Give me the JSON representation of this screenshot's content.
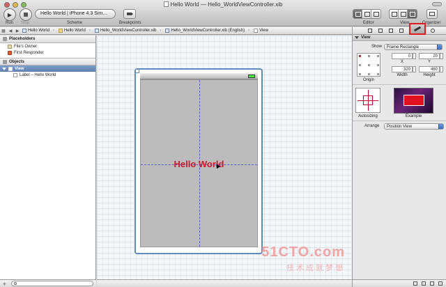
{
  "window": {
    "title": "Hello World — Hello_WorldViewController.xib"
  },
  "toolbar": {
    "run_label": "Run",
    "stop_label": "Stop",
    "scheme_value": "Hello World | iPhone 4.3 Sim…",
    "scheme_label": "Scheme",
    "breakpoints_label": "Breakpoints",
    "editor_label": "Editor",
    "view_label": "View",
    "organizer_label": "Organizer"
  },
  "jumpbar": {
    "crumbs": [
      "Hello World",
      "Hello World",
      "Hello_WorldViewController.xib",
      "Hello_WorldViewController.xib (English)",
      "View"
    ]
  },
  "navigator": {
    "placeholders_header": "Placeholders",
    "files_owner": "File's Owner",
    "first_responder": "First Responder",
    "objects_header": "Objects",
    "view_item": "View",
    "label_item": "Label – Hello World"
  },
  "canvas": {
    "label_text": "Hello World"
  },
  "watermark": {
    "logo": "51CTO.com",
    "sub": "技术成就梦想"
  },
  "inspector": {
    "section": "View",
    "show_label": "Show",
    "show_value": "Frame Rectangle",
    "x_value": "0",
    "y_value": "20",
    "x_label": "X",
    "y_label": "Y",
    "width_value": "320",
    "height_value": "460",
    "width_label": "Width",
    "height_label": "Height",
    "origin_label": "Origin",
    "autosizing_label": "Autosizing",
    "example_label": "Example",
    "arrange_label": "Arrange",
    "arrange_value": "Position View"
  }
}
